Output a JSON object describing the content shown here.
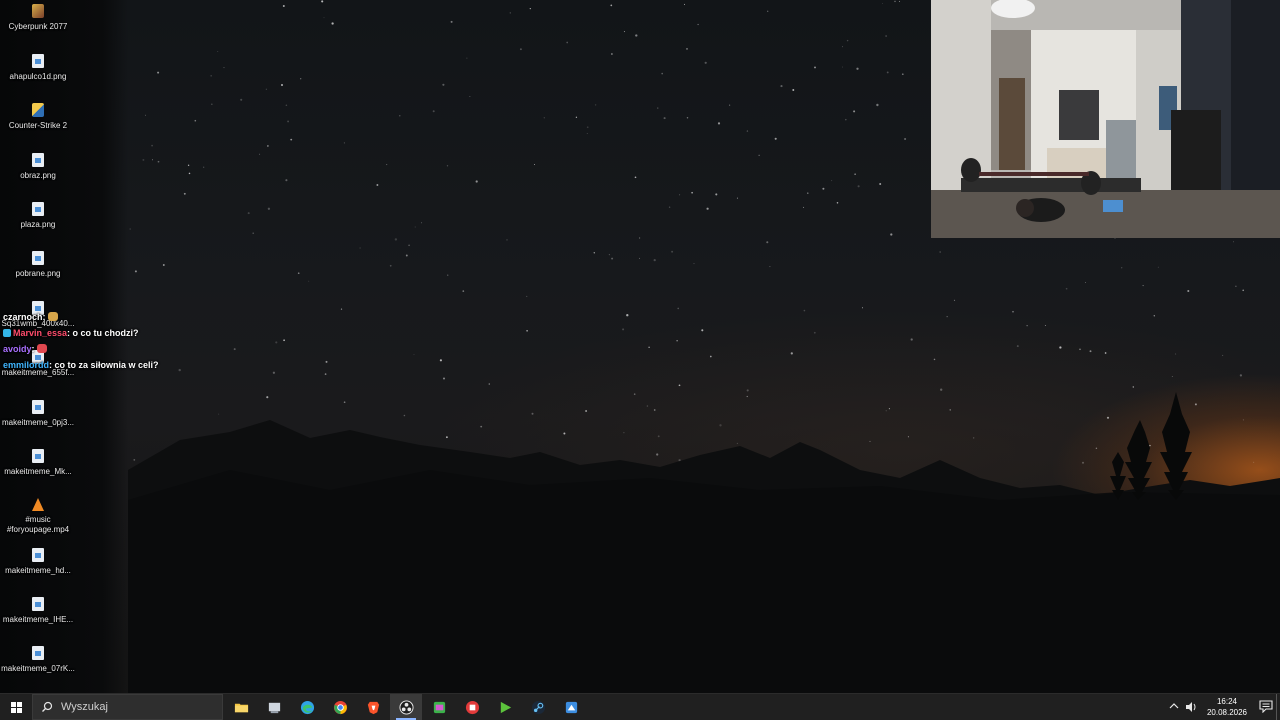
{
  "desktop": {
    "icons": [
      {
        "label": "Cyberpunk 2077",
        "icon": "cyberpunk-game-icon"
      },
      {
        "label": "ahapulco1d.png",
        "icon": "png-file-icon"
      },
      {
        "label": "Counter-Strike 2",
        "icon": "counter-strike-icon"
      },
      {
        "label": "obraz.png",
        "icon": "png-file-icon"
      },
      {
        "label": "plaza.png",
        "icon": "png-file-icon"
      },
      {
        "label": "pobrane.png",
        "icon": "png-file-icon"
      },
      {
        "label": "Sq31wmb_400x40...",
        "icon": "png-file-icon"
      },
      {
        "label": "makeitmeme_655f...",
        "icon": "png-file-icon"
      },
      {
        "label": "makeitmeme_0pj3...",
        "icon": "png-file-icon"
      },
      {
        "label": "makeitmeme_Mk...",
        "icon": "png-file-icon"
      },
      {
        "label": "#music\n#foryoupage.mp4",
        "label_line1": "#music",
        "label_line2": "#foryoupage.mp4",
        "icon": "vlc-media-icon"
      },
      {
        "label": "makeitmeme_hd...",
        "icon": "png-file-icon"
      },
      {
        "label": "makeitmeme_IHE...",
        "icon": "png-file-icon"
      },
      {
        "label": "makeitmeme_07rK...",
        "icon": "png-file-icon"
      }
    ]
  },
  "chat": {
    "messages": [
      {
        "user": "czarnoch",
        "user_color": "#ffffff",
        "text": ":",
        "emote": "pray-emote"
      },
      {
        "user": "Marvin_essa",
        "user_color": "#ff4d6d",
        "text": ": o co tu chodzi?",
        "badge": "cube-badge"
      },
      {
        "user": "avoidy",
        "user_color": "#a970ff",
        "text": ":",
        "emote": "face-emote"
      },
      {
        "user": "emmilordd",
        "user_color": "#3fb5ff",
        "text": ": co to za siłownia w celi?"
      }
    ]
  },
  "taskbar": {
    "search_placeholder": "Wyszukaj",
    "apps": [
      {
        "name": "file-explorer-icon",
        "color": "#f4c542"
      },
      {
        "name": "task-view-icon",
        "color": "#cfd6df"
      },
      {
        "name": "edge-browser-icon",
        "color": "#2fa3e6"
      },
      {
        "name": "chrome-browser-icon",
        "color": "#e94235"
      },
      {
        "name": "brave-browser-icon",
        "color": "#fb542b"
      },
      {
        "name": "obs-studio-icon",
        "color": "#e8e8e8"
      },
      {
        "name": "green-app-icon",
        "color": "#3bb34a"
      },
      {
        "name": "red-app-icon",
        "color": "#e23a3a"
      },
      {
        "name": "play-app-icon",
        "color": "#5cc33c"
      },
      {
        "name": "steam-icon",
        "color": "#66c0f4"
      },
      {
        "name": "blue-app-icon",
        "color": "#3c8de0"
      }
    ],
    "time": "16:24",
    "date": "20.08.2026"
  }
}
